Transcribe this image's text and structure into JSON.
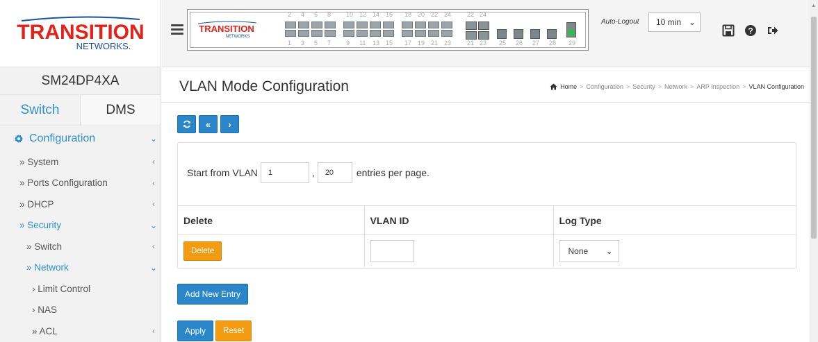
{
  "brand": {
    "name_line1": "TRANSITION",
    "name_line2": "NETWORKS.",
    "panel_line1": "TRANSITION",
    "panel_line2": "NETWORKS"
  },
  "sidebar": {
    "model": "SM24DP4XA",
    "tabs": [
      {
        "label": "Switch",
        "active": true
      },
      {
        "label": "DMS",
        "active": false
      }
    ],
    "menu": [
      {
        "label": "Configuration",
        "level": 0,
        "chevron": "⌄"
      },
      {
        "label": "» System",
        "level": 1,
        "chevron": "‹"
      },
      {
        "label": "» Ports Configuration",
        "level": 1,
        "chevron": "‹"
      },
      {
        "label": "» DHCP",
        "level": 1,
        "chevron": "‹"
      },
      {
        "label": "» Security",
        "level": 1,
        "chevron": "⌄",
        "active": true
      },
      {
        "label": "» Switch",
        "level": 2,
        "chevron": "‹"
      },
      {
        "label": "» Network",
        "level": 2,
        "chevron": "⌄",
        "active": true
      },
      {
        "label": "› Limit Control",
        "level": 3,
        "chevron": ""
      },
      {
        "label": "› NAS",
        "level": 3,
        "chevron": ""
      },
      {
        "label": "» ACL",
        "level": 3,
        "chevron": "‹"
      }
    ]
  },
  "topbar": {
    "port_numbers_top": [
      "2",
      "4",
      "6",
      "8",
      "10",
      "12",
      "14",
      "16",
      "18",
      "20",
      "22",
      "24",
      "22",
      "24"
    ],
    "port_numbers_bottom": [
      "1",
      "3",
      "5",
      "7",
      "9",
      "11",
      "13",
      "15",
      "17",
      "19",
      "21",
      "23",
      "21",
      "23",
      "25",
      "26",
      "27",
      "28",
      "29"
    ],
    "auto_logout_label": "Auto-Logout",
    "auto_logout_value": "10 min",
    "icons": [
      "save-icon",
      "help-icon",
      "logout-icon"
    ]
  },
  "page": {
    "title": "VLAN Mode Configuration",
    "breadcrumb": [
      "Home",
      "Configuration",
      "Security",
      "Network",
      "ARP Inspection",
      "VLAN Configuration"
    ]
  },
  "controls": {
    "start_label": "Start from VLAN",
    "start_value": "1",
    "comma": ",",
    "per_page_value": "20",
    "per_page_label": "entries per page."
  },
  "table": {
    "headers": [
      "Delete",
      "VLAN ID",
      "Log Type"
    ],
    "row": {
      "delete_label": "Delete",
      "vlan_id": "",
      "log_type": "None"
    }
  },
  "buttons": {
    "add_new_entry": "Add New Entry",
    "apply": "Apply",
    "reset": "Reset"
  },
  "colors": {
    "accent": "#2e8ece",
    "primary_btn": "#2a86c8",
    "warning_btn": "#f39c12",
    "brand_red": "#e2231a",
    "brand_blue": "#1c4f9c"
  }
}
